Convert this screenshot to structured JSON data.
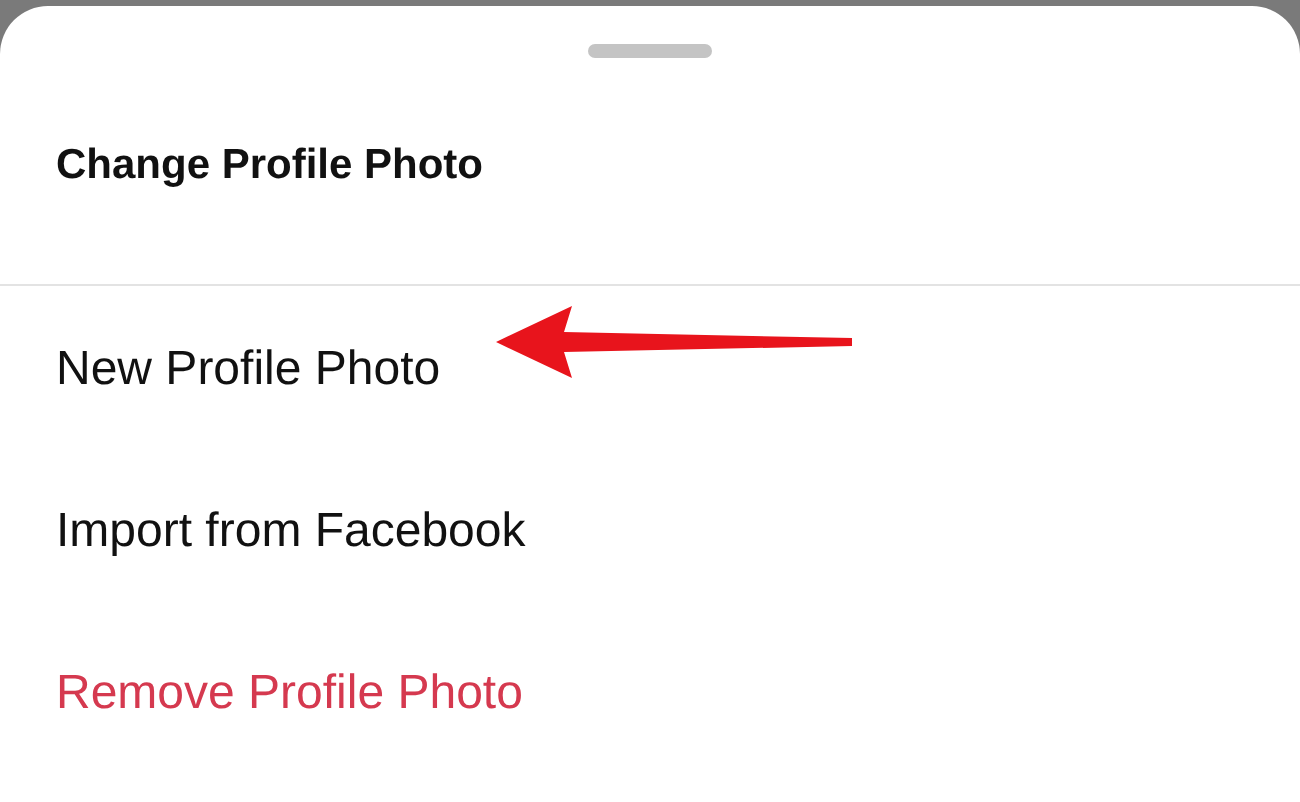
{
  "sheet": {
    "title": "Change Profile Photo",
    "options": [
      {
        "label": "New Profile Photo",
        "kind": "normal",
        "pointed": true
      },
      {
        "label": "Import from Facebook",
        "kind": "normal",
        "pointed": false
      },
      {
        "label": "Remove Profile Photo",
        "kind": "destructive",
        "pointed": false
      }
    ]
  }
}
